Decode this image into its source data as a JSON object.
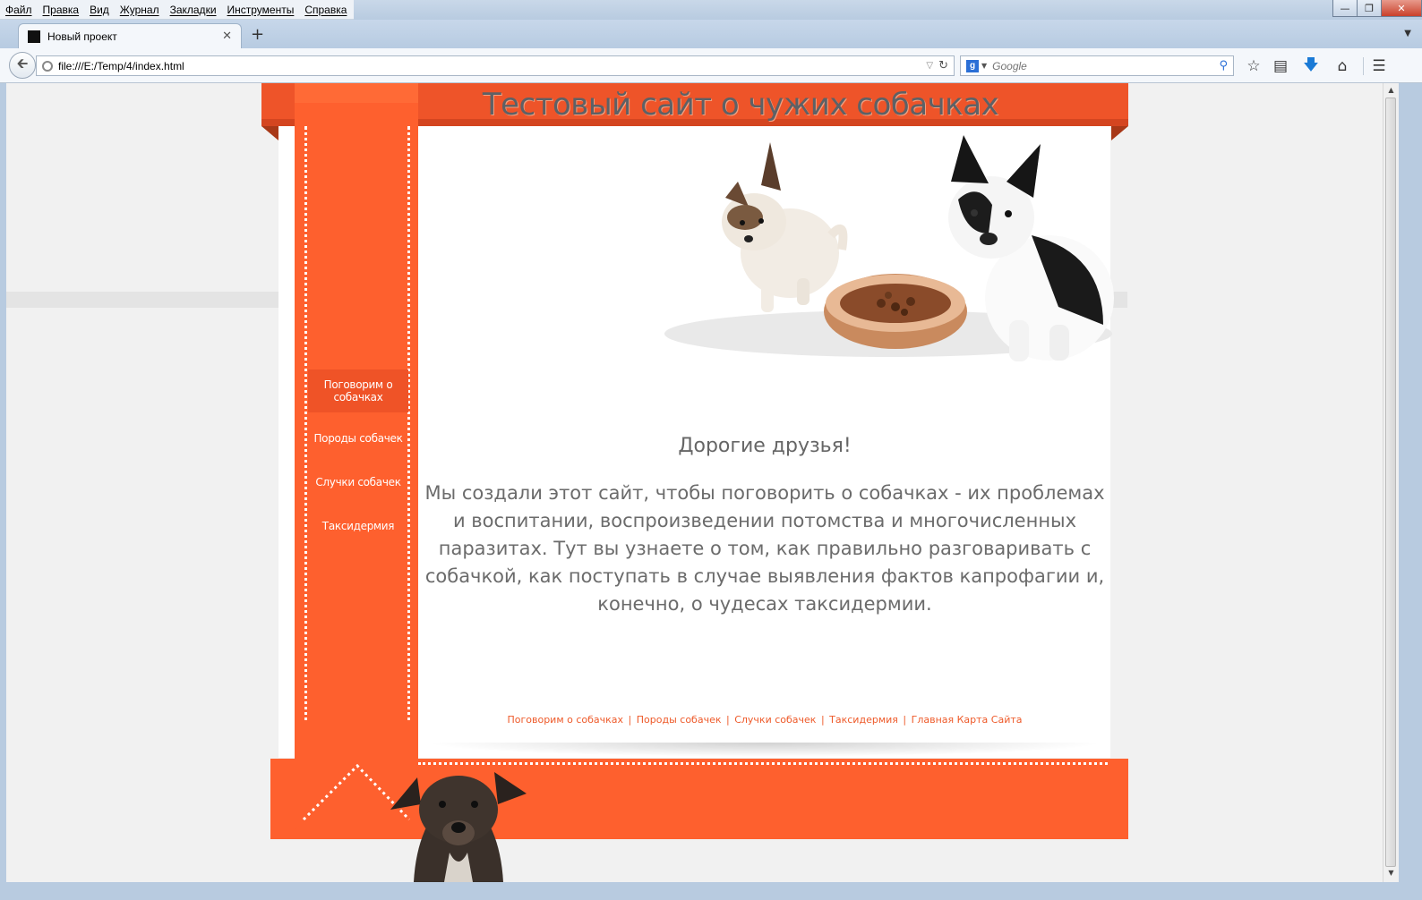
{
  "menu": [
    "Файл",
    "Правка",
    "Вид",
    "Журнал",
    "Закладки",
    "Инструменты",
    "Справка"
  ],
  "tab": {
    "title": "Новый проект"
  },
  "address": {
    "url": "file:///E:/Temp/4/index.html"
  },
  "search": {
    "placeholder": "Google"
  },
  "site": {
    "title": "Тестовый сайт о чужих собачках",
    "nav": [
      "Поговорим о собачках",
      "Породы собачек",
      "Случки собачек",
      "Таксидермия"
    ],
    "greeting": "Дорогие друзья!",
    "intro": "Мы создали этот сайт, чтобы поговорить о собачках - их проблемах и воспитании, воспроизведении потомства и многочисленных паразитах. Тут вы узнаете о том, как правильно разговаривать с собачкой, как поступать в случае выявления фактов капрофагии и, конечно, о чудесах таксидермии.",
    "footer_links": [
      "Поговорим о собачках",
      "Породы собачек",
      "Случки собачек",
      "Таксидермия",
      "Главная Карта Сайта"
    ],
    "footer_separator": "|"
  },
  "colors": {
    "accent": "#fe602e",
    "header": "#ee5429",
    "text": "#6b6b6b"
  }
}
